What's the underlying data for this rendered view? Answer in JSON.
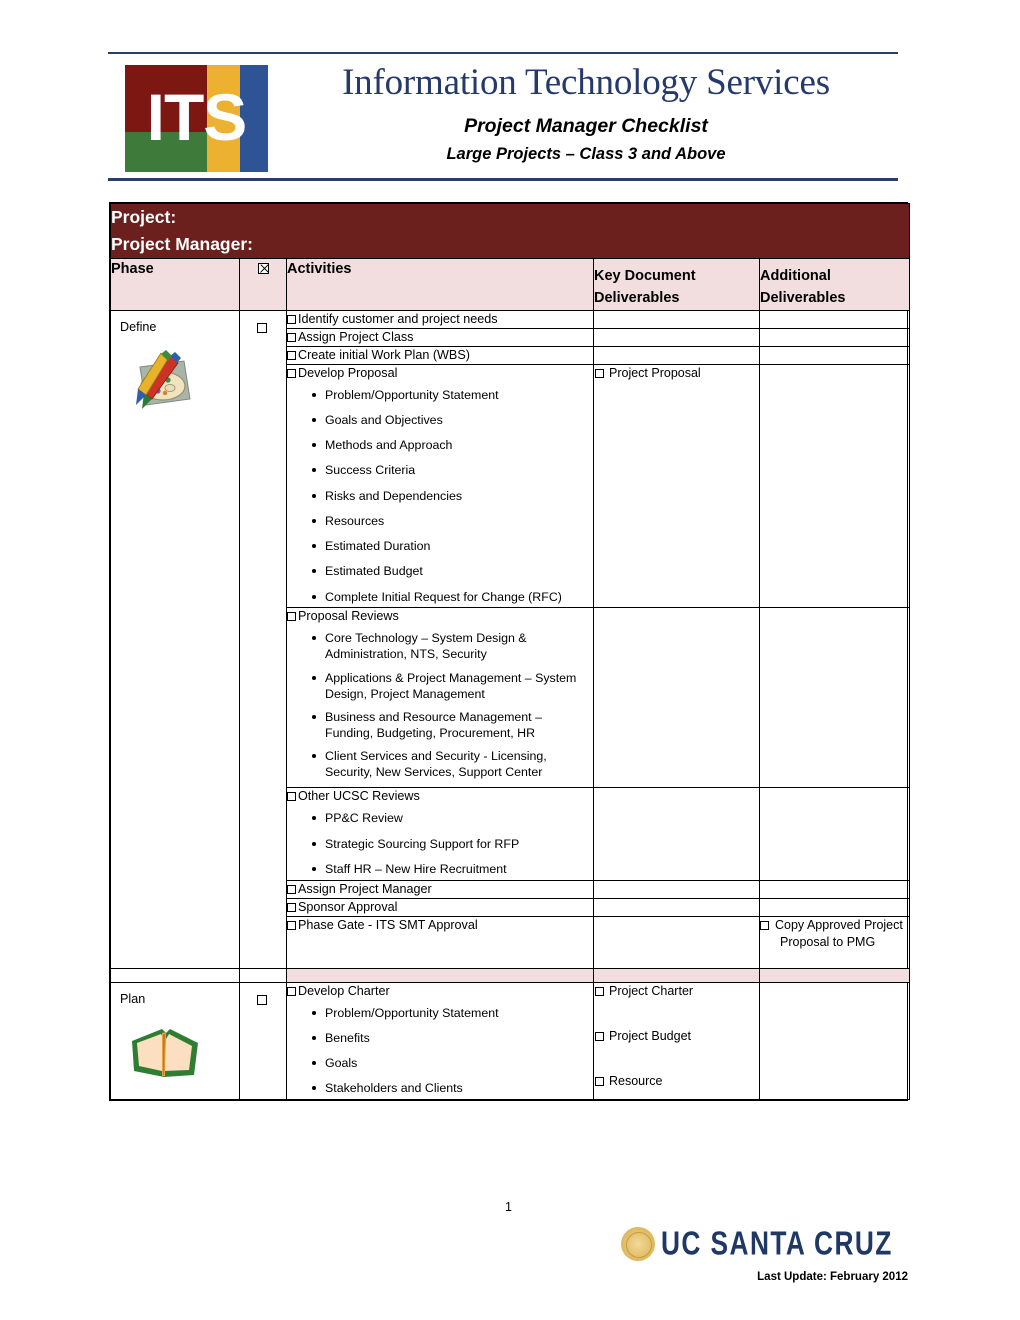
{
  "header": {
    "logo_text": "ITS",
    "logo_colors": {
      "dark_red": "#7d1712",
      "gold": "#edb131",
      "blue": "#2e5496",
      "green": "#3e7a3a"
    },
    "title": "Information Technology Services",
    "subtitle1": "Project Manager Checklist",
    "subtitle2": "Large Projects – Class 3 and Above",
    "rule_color": "#2a3f66"
  },
  "table": {
    "banner_color": "#6b201d",
    "header_bg": "#f2dede",
    "banner": {
      "project_label": "Project:",
      "project_manager_label": "Project Manager:"
    },
    "columns": {
      "phase": "Phase",
      "check": "☒",
      "activities": "Activities",
      "key_deliverables": "Key Document\nDeliverables",
      "key_deliverables_l1": "Key Document",
      "key_deliverables_l2": "Deliverables",
      "additional_deliverables_l1": "Additional",
      "additional_deliverables_l2": "Deliverables"
    },
    "phases": [
      {
        "name": "Define",
        "icon": "palette-icon",
        "rows": [
          {
            "activity": "Identify customer and project needs",
            "sub": [],
            "key": [],
            "additional": []
          },
          {
            "activity": "Assign Project Class",
            "sub": [],
            "key": [],
            "additional": []
          },
          {
            "activity": "Create initial  Work Plan (WBS)",
            "sub": [],
            "key": [],
            "additional": []
          },
          {
            "activity": "Develop Proposal",
            "sub": [
              "Problem/Opportunity Statement",
              "Goals and Objectives",
              "Methods and Approach",
              "Success Criteria",
              "Risks and Dependencies",
              "Resources",
              "Estimated Duration",
              "Estimated Budget",
              "Complete Initial Request for Change (RFC)"
            ],
            "key": [
              "Project Proposal"
            ],
            "additional": []
          },
          {
            "activity": "Proposal Reviews",
            "sub": [
              "Core Technology – System Design & Administration, NTS, Security",
              "Applications & Project Management – System Design, Project Management",
              "Business and Resource Management – Funding, Budgeting, Procurement, HR",
              "Client Services and Security - Licensing, Security, New Services, Support Center"
            ],
            "key": [],
            "additional": []
          },
          {
            "activity": "Other UCSC Reviews",
            "sub": [
              "PP&C Review",
              "Strategic Sourcing Support for RFP",
              "Staff HR – New Hire Recruitment"
            ],
            "key": [],
            "additional": []
          },
          {
            "activity": "Assign Project Manager",
            "sub": [],
            "key": [],
            "additional": []
          },
          {
            "activity": "Sponsor Approval",
            "sub": [],
            "key": [],
            "additional": []
          },
          {
            "activity": "Phase Gate - ITS SMT Approval",
            "sub": [],
            "key": [],
            "additional": [
              "Copy Approved Project Proposal to PMG"
            ]
          }
        ]
      },
      {
        "name": "Plan",
        "icon": "open-book-icon",
        "rows": [
          {
            "activity": "Develop Charter",
            "sub": [
              "Problem/Opportunity Statement",
              "Benefits",
              "Goals",
              "Stakeholders and Clients"
            ],
            "key": [
              "Project Charter",
              "Project Budget",
              "Resource"
            ],
            "additional": []
          }
        ]
      }
    ]
  },
  "footer": {
    "page_number": "1",
    "university": "UC SANTA CRUZ",
    "last_update": "Last Update: February 2012"
  }
}
